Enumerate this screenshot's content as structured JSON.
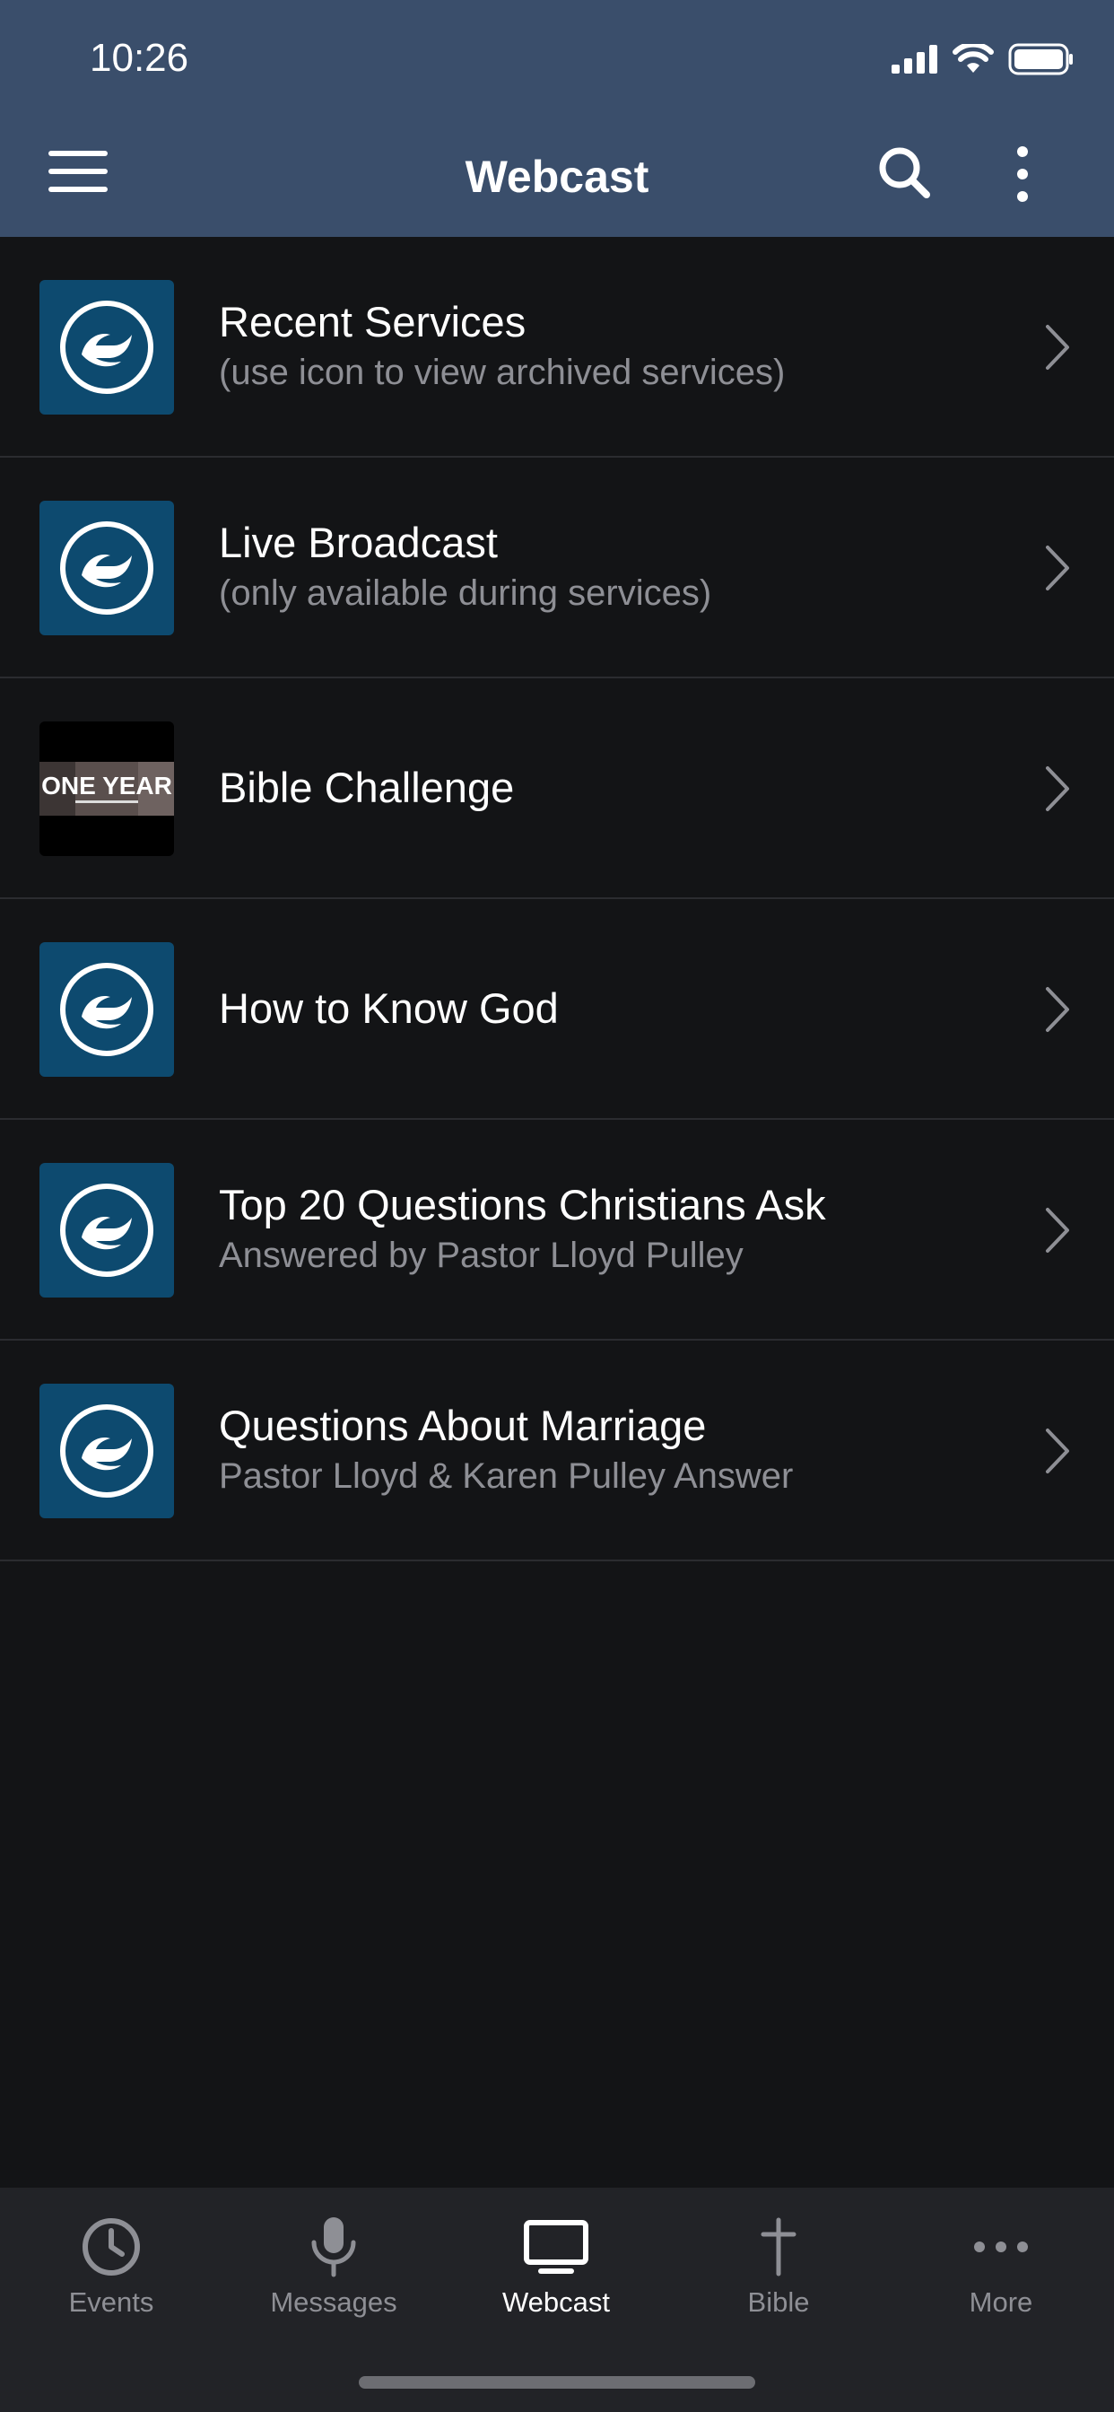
{
  "status_bar": {
    "time": "10:26"
  },
  "header": {
    "title": "Webcast",
    "icons": [
      "hamburger-menu-icon",
      "search-icon",
      "more-vertical-icon"
    ]
  },
  "list": [
    {
      "title": "Recent Services",
      "subtitle": "(use icon to view archived services)",
      "thumb": "logo"
    },
    {
      "title": "Live Broadcast",
      "subtitle": "(only available during services)",
      "thumb": "logo"
    },
    {
      "title": "Bible Challenge",
      "subtitle": "",
      "thumb": "one-year",
      "thumb_text": "ONE YEAR"
    },
    {
      "title": "How to Know God",
      "subtitle": "",
      "thumb": "logo"
    },
    {
      "title": "Top 20 Questions Christians Ask",
      "subtitle": "Answered by Pastor Lloyd Pulley",
      "thumb": "logo"
    },
    {
      "title": "Questions About Marriage",
      "subtitle": "Pastor Lloyd & Karen Pulley Answer",
      "thumb": "logo"
    }
  ],
  "tabs": [
    {
      "label": "Events",
      "icon": "clock-icon",
      "active": false
    },
    {
      "label": "Messages",
      "icon": "microphone-icon",
      "active": false
    },
    {
      "label": "Webcast",
      "icon": "monitor-icon",
      "active": true
    },
    {
      "label": "Bible",
      "icon": "cross-icon",
      "active": false
    },
    {
      "label": "More",
      "icon": "ellipsis-icon",
      "active": false
    }
  ],
  "colors": {
    "header_bg": "#3a4e6b",
    "page_bg": "#131416",
    "thumb_bg": "#0d4a6f",
    "tabbar_bg": "#222327",
    "muted_text": "#8e8f95"
  }
}
